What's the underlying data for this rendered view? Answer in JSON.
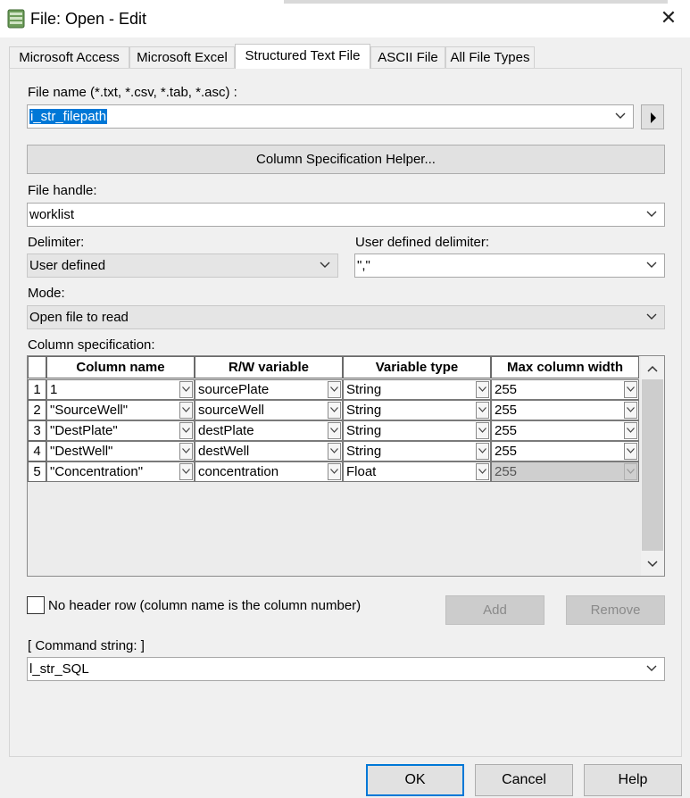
{
  "window": {
    "title": "File: Open - Edit",
    "close_glyph": "✕"
  },
  "tabs": [
    {
      "label": "Microsoft Access"
    },
    {
      "label": "Microsoft Excel"
    },
    {
      "label": "Structured Text File"
    },
    {
      "label": "ASCII File"
    },
    {
      "label": "All File Types"
    }
  ],
  "active_tab": "Structured Text File",
  "file_name": {
    "label": "File name (*.txt, *.csv, *.tab, *.asc) :",
    "value": "i_str_filepath"
  },
  "column_helper_button": "Column Specification Helper...",
  "file_handle": {
    "label": "File handle:",
    "value": "worklist"
  },
  "delimiter": {
    "label": "Delimiter:",
    "value": "User defined"
  },
  "user_delimiter": {
    "label": "User defined delimiter:",
    "value": "\",\""
  },
  "mode": {
    "label": "Mode:",
    "value": "Open file to read"
  },
  "column_spec": {
    "label": "Column specification:",
    "headers": [
      "Column name",
      "R/W variable",
      "Variable type",
      "Max column width"
    ],
    "rows": [
      {
        "num": "1",
        "name": "1",
        "variable": "sourcePlate",
        "type": "String",
        "width": "255"
      },
      {
        "num": "2",
        "name": "\"SourceWell\"",
        "variable": "sourceWell",
        "type": "String",
        "width": "255"
      },
      {
        "num": "3",
        "name": "\"DestPlate\"",
        "variable": "destPlate",
        "type": "String",
        "width": "255"
      },
      {
        "num": "4",
        "name": "\"DestWell\"",
        "variable": "destWell",
        "type": "String",
        "width": "255"
      },
      {
        "num": "5",
        "name": "\"Concentration\"",
        "variable": "concentration",
        "type": "Float",
        "width": "255"
      }
    ]
  },
  "no_header_checkbox": {
    "label": "No header row (column name is the column number)",
    "checked": false
  },
  "add_button": "Add",
  "remove_button": "Remove",
  "command_string": {
    "label": "[ Command string: ]",
    "value": "l_str_SQL"
  },
  "footer": {
    "ok": "OK",
    "cancel": "Cancel",
    "help": "Help"
  },
  "colors": {
    "accent": "#0078d7",
    "disabled_cell": "#cfcfcf"
  }
}
